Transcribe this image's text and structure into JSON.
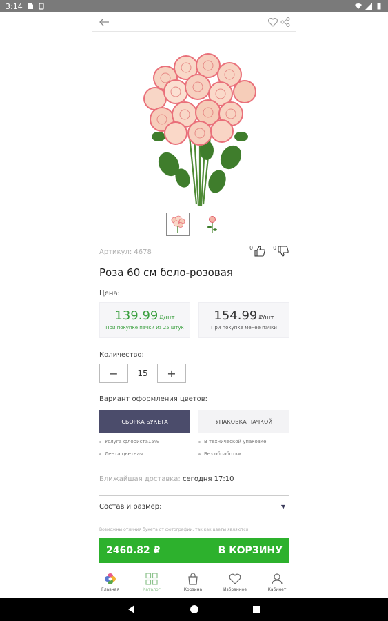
{
  "status_bar": {
    "time": "3:14",
    "icons": [
      "sd-card-icon",
      "notification-icon",
      "wifi-icon",
      "signal-icon",
      "battery-icon"
    ]
  },
  "header": {
    "back_icon": "arrow-left-icon",
    "favorite_icon": "heart-icon",
    "share_icon": "share-icon"
  },
  "product": {
    "article": "Артикул: 4678",
    "likes": "0",
    "dislikes": "0",
    "title": "Роза 60 см бело-розовая",
    "price_label": "Цена:",
    "prices": [
      {
        "value": "139.99",
        "unit": "₽/шт",
        "note": "При покупке пачки из 25 штук"
      },
      {
        "value": "154.99",
        "unit": "₽/шт",
        "note": "При покупке менее пачки"
      }
    ],
    "quantity_label": "Количество:",
    "quantity": "15",
    "variant_label": "Вариант оформления цветов:",
    "variants": [
      "СБОРКА БУКЕТА",
      "УПАКОВКА ПАЧКОЙ"
    ],
    "variant_bullets_1": [
      "Услуга флориста15%",
      "Лента цветная"
    ],
    "variant_bullets_2": [
      "В технической упаковке",
      "Без обработки"
    ],
    "delivery_label": "Ближайшая доставка:",
    "delivery_value": "сегодня 17:10",
    "composition_label": "Состав и размер:",
    "disclaimer": "Возможны отличия букета от фотографии, так как цветы являются",
    "total": "2460.82 ₽",
    "cart_button": "В КОРЗИНУ"
  },
  "tabs": [
    {
      "label": "Главная",
      "icon": "flower-logo-icon"
    },
    {
      "label": "Каталог",
      "icon": "grid-icon"
    },
    {
      "label": "Корзина",
      "icon": "bag-icon"
    },
    {
      "label": "Избранное",
      "icon": "heart-icon"
    },
    {
      "label": "Кабинет",
      "icon": "user-icon"
    }
  ],
  "colors": {
    "accent_green": "#2db12d",
    "price_green": "#3a9f3e",
    "variant_active": "#4b4c6b",
    "tab_active": "#8bc28b"
  }
}
